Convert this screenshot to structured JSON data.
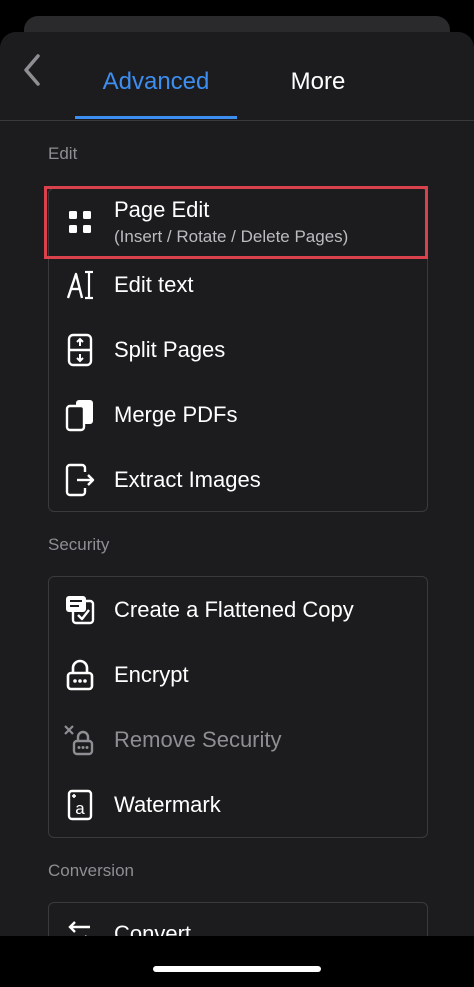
{
  "tabs": {
    "advanced": "Advanced",
    "more": "More",
    "active": "Advanced"
  },
  "sections": {
    "edit": {
      "title": "Edit",
      "items": [
        {
          "label": "Page Edit",
          "sub": "(Insert / Rotate / Delete Pages)",
          "icon": "grid-icon",
          "highlighted": true
        },
        {
          "label": "Edit text",
          "icon": "edit-text-icon"
        },
        {
          "label": "Split Pages",
          "icon": "split-pages-icon"
        },
        {
          "label": "Merge PDFs",
          "icon": "merge-pdfs-icon"
        },
        {
          "label": "Extract Images",
          "icon": "extract-images-icon"
        }
      ]
    },
    "security": {
      "title": "Security",
      "items": [
        {
          "label": "Create a Flattened Copy",
          "icon": "flattened-copy-icon"
        },
        {
          "label": "Encrypt",
          "icon": "lock-icon"
        },
        {
          "label": "Remove Security",
          "icon": "unlock-icon",
          "disabled": true
        },
        {
          "label": "Watermark",
          "icon": "watermark-icon"
        }
      ]
    },
    "conversion": {
      "title": "Conversion",
      "items": [
        {
          "label": "Convert",
          "icon": "convert-icon"
        }
      ]
    }
  },
  "colors": {
    "accent": "#3c8ef0",
    "highlight_border": "#d9414d",
    "background": "#000000",
    "sheet": "#1c1c1e",
    "muted_text": "#8e8e93"
  }
}
